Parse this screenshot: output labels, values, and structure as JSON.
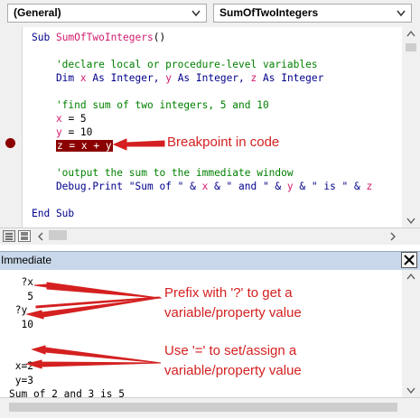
{
  "toolbar": {
    "object_dropdown": "(General)",
    "procedure_dropdown": "SumOfTwoIntegers"
  },
  "code": {
    "lines": [
      {
        "parts": [
          {
            "t": "Sub ",
            "c": "kw"
          },
          {
            "t": "SumOfTwoIntegers",
            "c": "vr"
          },
          {
            "t": "()",
            "c": ""
          }
        ]
      },
      {
        "parts": []
      },
      {
        "parts": [
          {
            "t": "    'declare local or procedure-level variables",
            "c": "cm"
          }
        ]
      },
      {
        "parts": [
          {
            "t": "    Dim ",
            "c": "kw"
          },
          {
            "t": "x",
            "c": "vr"
          },
          {
            "t": " As Integer, ",
            "c": "kw"
          },
          {
            "t": "y",
            "c": "vr"
          },
          {
            "t": " As Integer, ",
            "c": "kw"
          },
          {
            "t": "z",
            "c": "vr"
          },
          {
            "t": " As Integer",
            "c": "kw"
          }
        ]
      },
      {
        "parts": []
      },
      {
        "parts": [
          {
            "t": "    'find sum of two integers, 5 and 10",
            "c": "cm"
          }
        ]
      },
      {
        "parts": [
          {
            "t": "    ",
            "c": ""
          },
          {
            "t": "x",
            "c": "vr"
          },
          {
            "t": " = 5",
            "c": ""
          }
        ]
      },
      {
        "parts": [
          {
            "t": "    ",
            "c": ""
          },
          {
            "t": "y",
            "c": "vr"
          },
          {
            "t": " = 10",
            "c": ""
          }
        ]
      },
      {
        "parts": [
          {
            "t": "    ",
            "c": ""
          },
          {
            "t": "z = x + y",
            "c": "hl"
          }
        ]
      },
      {
        "parts": []
      },
      {
        "parts": [
          {
            "t": "    'output the sum to the immediate window",
            "c": "cm"
          }
        ]
      },
      {
        "parts": [
          {
            "t": "    Debug.Print \"Sum of \" & ",
            "c": "kw"
          },
          {
            "t": "x",
            "c": "vr"
          },
          {
            "t": " & \" and \" & ",
            "c": "kw"
          },
          {
            "t": "y",
            "c": "vr"
          },
          {
            "t": " & \" is \" & ",
            "c": "kw"
          },
          {
            "t": "z",
            "c": "vr"
          }
        ]
      },
      {
        "parts": []
      },
      {
        "parts": [
          {
            "t": "End Sub",
            "c": "kw"
          }
        ]
      }
    ]
  },
  "immediate": {
    "title": "Immediate",
    "lines": [
      "  ?x",
      "   5",
      " ?y",
      "  10",
      "",
      "",
      " x=2",
      " y=3",
      "Sum of 2 and 3 is 5"
    ]
  },
  "annotations": {
    "breakpoint": "Breakpoint in code",
    "prefix_line1": "Prefix with '?' to get a",
    "prefix_line2": "variable/property value",
    "assign_line1": "Use '=' to set/assign a",
    "assign_line2": "variable/property value"
  },
  "colors": {
    "annotation": "#d42020",
    "breakpoint": "#8b0000",
    "keyword": "#00008b",
    "comment": "#008000",
    "variable": "#d11b6e"
  }
}
